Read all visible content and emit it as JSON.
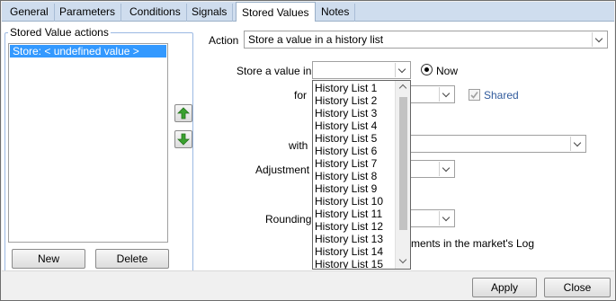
{
  "tabs": [
    "General",
    "Parameters",
    "Conditions",
    "Signals",
    "Stored Values",
    "Notes"
  ],
  "groupbox": {
    "title": "Stored Value actions",
    "items": [
      "Store: < undefined value >"
    ],
    "new_label": "New",
    "delete_label": "Delete",
    "move_up_icon": "green-up-arrow-icon",
    "move_down_icon": "green-down-arrow-icon"
  },
  "form": {
    "action_label": "Action",
    "action_value": "Store a value in a history list",
    "store_label": "Store a value in",
    "store_value": "",
    "now_label": "Now",
    "for_label": "for",
    "shared_label": "Shared",
    "with_label": "with",
    "adjustment_label": "Adjustment",
    "rounding_label": "Rounding",
    "log_text_visible": "ments in the market's Log"
  },
  "dropdown": {
    "options": [
      "History List 1",
      "History List 2",
      "History List 3",
      "History List 4",
      "History List 5",
      "History List 6",
      "History List 7",
      "History List 8",
      "History List 9",
      "History List 10",
      "History List 11",
      "History List 12",
      "History List 13",
      "History List 14",
      "History List 15"
    ]
  },
  "buttons": {
    "apply_label": "Apply",
    "close_label": "Close"
  },
  "colors": {
    "selection": "#3399ff",
    "tab_strip": "#cfddee",
    "group_border": "#9bb9e3"
  }
}
